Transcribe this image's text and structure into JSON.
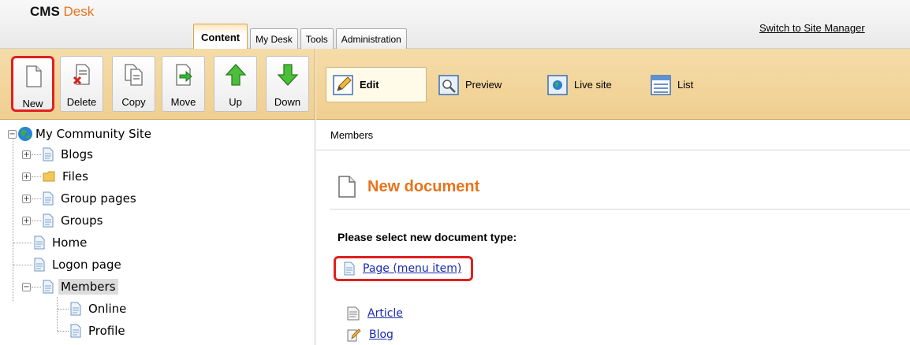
{
  "header": {
    "logo_part1": "CMS",
    "logo_part2": "Desk",
    "tabs": [
      {
        "label": "Content",
        "active": true
      },
      {
        "label": "My Desk",
        "active": false
      },
      {
        "label": "Tools",
        "active": false
      },
      {
        "label": "Administration",
        "active": false
      }
    ],
    "switch_link": "Switch to Site Manager"
  },
  "actions": [
    {
      "label": "New",
      "icon": "new-document-icon"
    },
    {
      "label": "Delete",
      "icon": "delete-document-icon"
    },
    {
      "label": "Copy",
      "icon": "copy-document-icon"
    },
    {
      "label": "Move",
      "icon": "move-document-icon"
    },
    {
      "label": "Up",
      "icon": "arrow-up-icon"
    },
    {
      "label": "Down",
      "icon": "arrow-down-icon"
    }
  ],
  "view_modes": [
    {
      "label": "Edit",
      "icon": "edit-pencil-icon",
      "active": true
    },
    {
      "label": "Preview",
      "icon": "preview-magnifier-icon",
      "active": false
    },
    {
      "label": "Live site",
      "icon": "live-site-globe-icon",
      "active": false
    },
    {
      "label": "List",
      "icon": "list-icon",
      "active": false
    }
  ],
  "tree": {
    "root": "My Community Site",
    "items": [
      {
        "label": "Blogs"
      },
      {
        "label": "Files"
      },
      {
        "label": "Group pages"
      },
      {
        "label": "Groups"
      },
      {
        "label": "Home"
      },
      {
        "label": "Logon page"
      },
      {
        "label": "Members"
      },
      {
        "label": "Online"
      },
      {
        "label": "Profile"
      }
    ]
  },
  "content": {
    "breadcrumb": "Members",
    "title": "New document",
    "prompt": "Please select new document type:",
    "doc_types": [
      {
        "label": "Page (menu item)",
        "icon": "page-icon"
      },
      {
        "label": "Article",
        "icon": "article-icon"
      },
      {
        "label": "Blog",
        "icon": "blog-icon"
      }
    ]
  },
  "colors": {
    "accent_orange": "#e8731c",
    "toolbar_bg": "#f0cf90",
    "highlight_red": "#e02020",
    "link_blue": "#1a2bb0"
  }
}
